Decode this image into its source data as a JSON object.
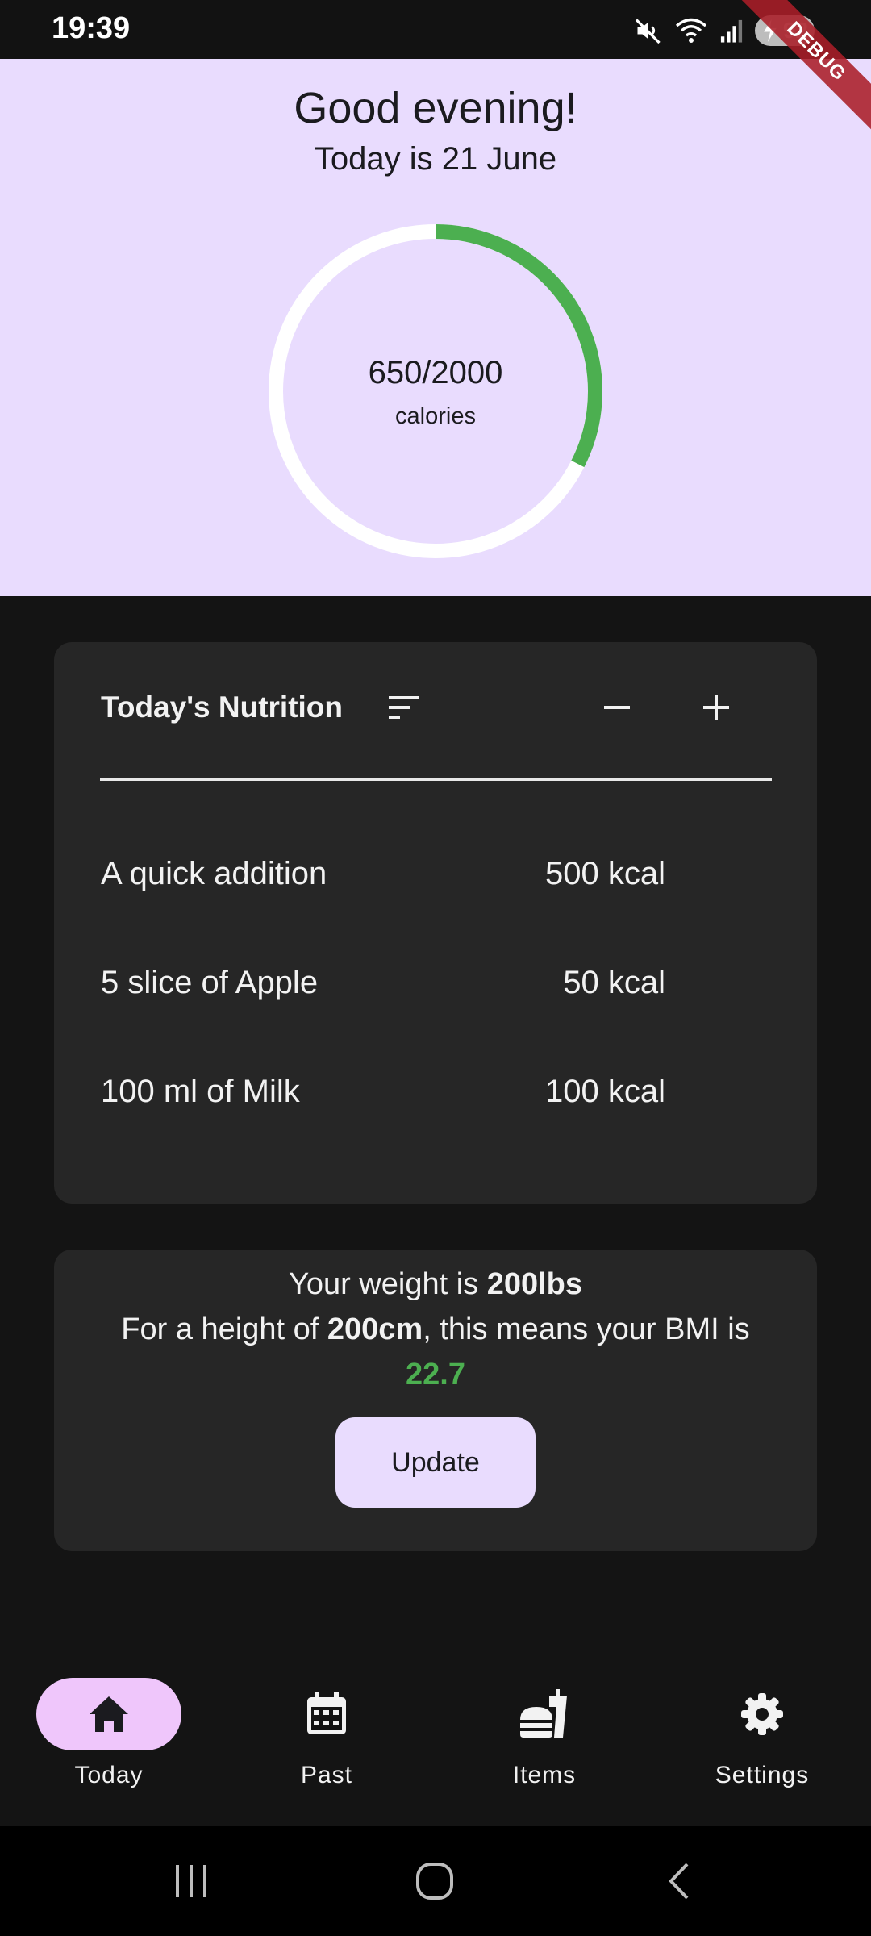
{
  "status_bar": {
    "time": "19:39",
    "battery_level": "92"
  },
  "debug_banner": "DEBUG",
  "header": {
    "greeting": "Good evening!",
    "date": "Today is 21 June",
    "calories_text": "650/2000",
    "calories_unit": "calories",
    "calories_consumed": 650,
    "calories_goal": 2000,
    "progress_color": "#4caf50",
    "track_color": "#ffffff"
  },
  "nutrition": {
    "title": "Today's Nutrition",
    "items": [
      {
        "name": "A quick addition",
        "kcal": "500 kcal"
      },
      {
        "name": "5 slice of Apple",
        "kcal": "50 kcal"
      },
      {
        "name": "100 ml of Milk",
        "kcal": "100 kcal"
      }
    ]
  },
  "bmi": {
    "weight_prefix": "Your weight is ",
    "weight": "200lbs",
    "height_prefix": "For a height of ",
    "height": "200cm",
    "height_suffix": ", this means your BMI is",
    "bmi_value": "22.7",
    "update_label": "Update"
  },
  "bottom_nav": {
    "items": [
      {
        "label": "Today",
        "icon": "home-icon",
        "active": true
      },
      {
        "label": "Past",
        "icon": "calendar-icon",
        "active": false
      },
      {
        "label": "Items",
        "icon": "fastfood-icon",
        "active": false
      },
      {
        "label": "Settings",
        "icon": "gear-icon",
        "active": false
      }
    ]
  },
  "colors": {
    "accent": "#e9dcfe",
    "nav_indicator": "#efc6fb",
    "card": "#262626",
    "background": "#141414",
    "bmi_green": "#4caf50"
  }
}
